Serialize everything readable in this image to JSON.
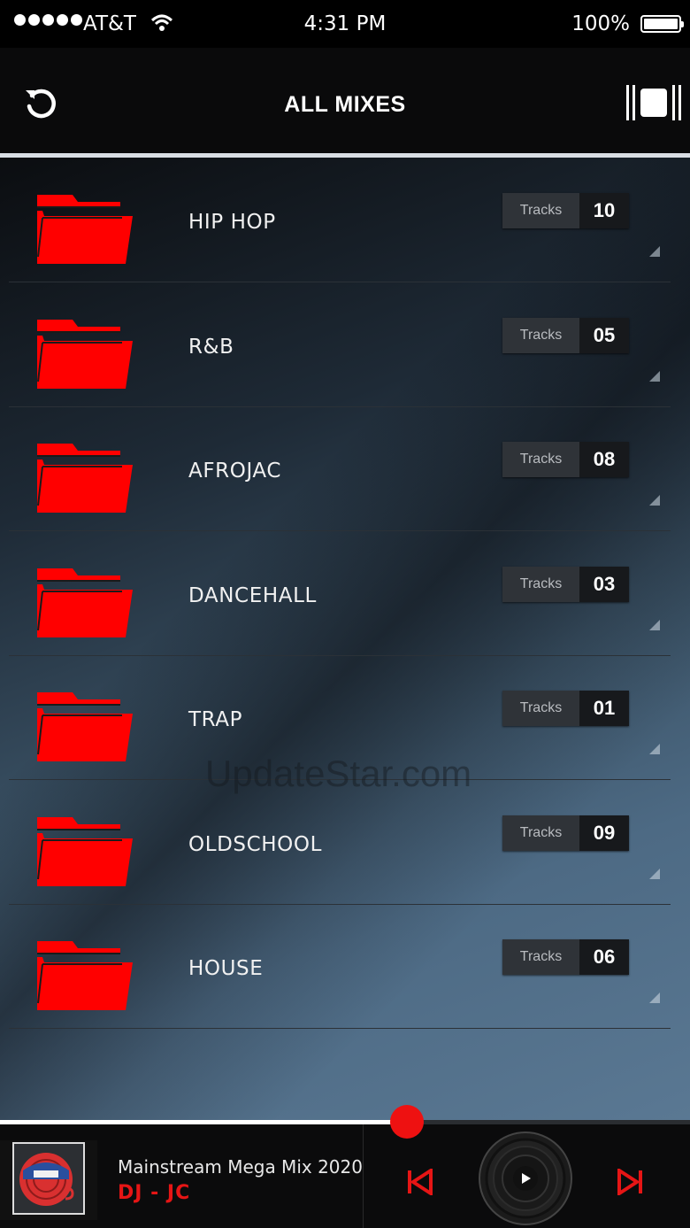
{
  "status_bar": {
    "carrier": "AT&T",
    "time": "4:31 PM",
    "battery": "100%"
  },
  "header": {
    "title": "ALL MIXES"
  },
  "colors": {
    "accent": "#ee1111",
    "folder": "#ff0000",
    "header_bg": "#0a0a0b"
  },
  "badge_label": "Tracks",
  "categories": [
    {
      "name": "HIP HOP",
      "tracks": "10"
    },
    {
      "name": "R&B",
      "tracks": "05"
    },
    {
      "name": "AFROJAC",
      "tracks": "08"
    },
    {
      "name": "DANCEHALL",
      "tracks": "03"
    },
    {
      "name": "TRAP",
      "tracks": "01"
    },
    {
      "name": "OLDSCHOOL",
      "tracks": "09"
    },
    {
      "name": "HOUSE",
      "tracks": "06"
    }
  ],
  "watermark": "UpdateStar.com",
  "player": {
    "track_title": "Mainstream Mega Mix 2020",
    "artist": "DJ - JC",
    "progress": 0.59
  },
  "icons": {
    "refresh": "refresh-icon",
    "menu": "menu-icon",
    "folder": "folder-icon",
    "prev": "skip-previous-icon",
    "next": "skip-next-icon",
    "play": "play-icon"
  }
}
